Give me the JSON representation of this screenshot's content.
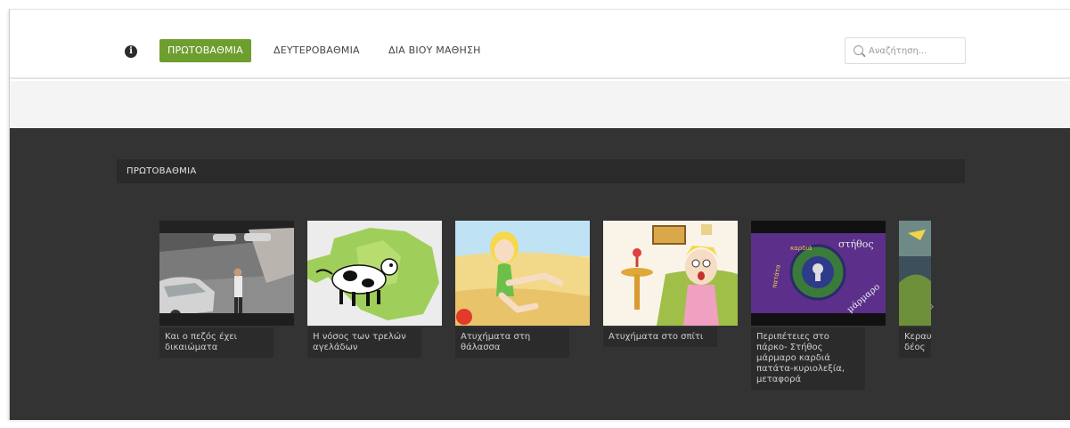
{
  "nav": {
    "items": [
      {
        "label": "ΠΡΩΤΟΒΑΘΜΙΑ",
        "active": true
      },
      {
        "label": "ΔΕΥΤΕΡΟΒΑΘΜΙΑ",
        "active": false
      },
      {
        "label": "ΔΙΑ ΒΙΟΥ ΜΑΘΗΣΗ",
        "active": false
      }
    ],
    "accent_color": "#6d9e2e"
  },
  "search": {
    "placeholder": "Αναζήτηση..."
  },
  "section": {
    "title": "ΠΡΩΤΟΒΑΘΜΙΑ",
    "videos": [
      {
        "title": "Και ο πεζός έχει δικαιώματα"
      },
      {
        "title": "Η νόσος των τρελών αγελάδων"
      },
      {
        "title": "Ατυχήματα στη θάλασσα"
      },
      {
        "title": "Ατυχήματα στο σπίτι"
      },
      {
        "title": "Περιπέτειες στο πάρκο- Στήθος μάρμαρο καρδιά πατάτα-κυριολεξία, μεταφορά"
      },
      {
        "title": "Κεραυ δέος"
      }
    ]
  },
  "thumbnail_art": {
    "video_4": [
      "στήθος",
      "μάρμαρο",
      "καρδιά",
      "πατάτα"
    ]
  }
}
